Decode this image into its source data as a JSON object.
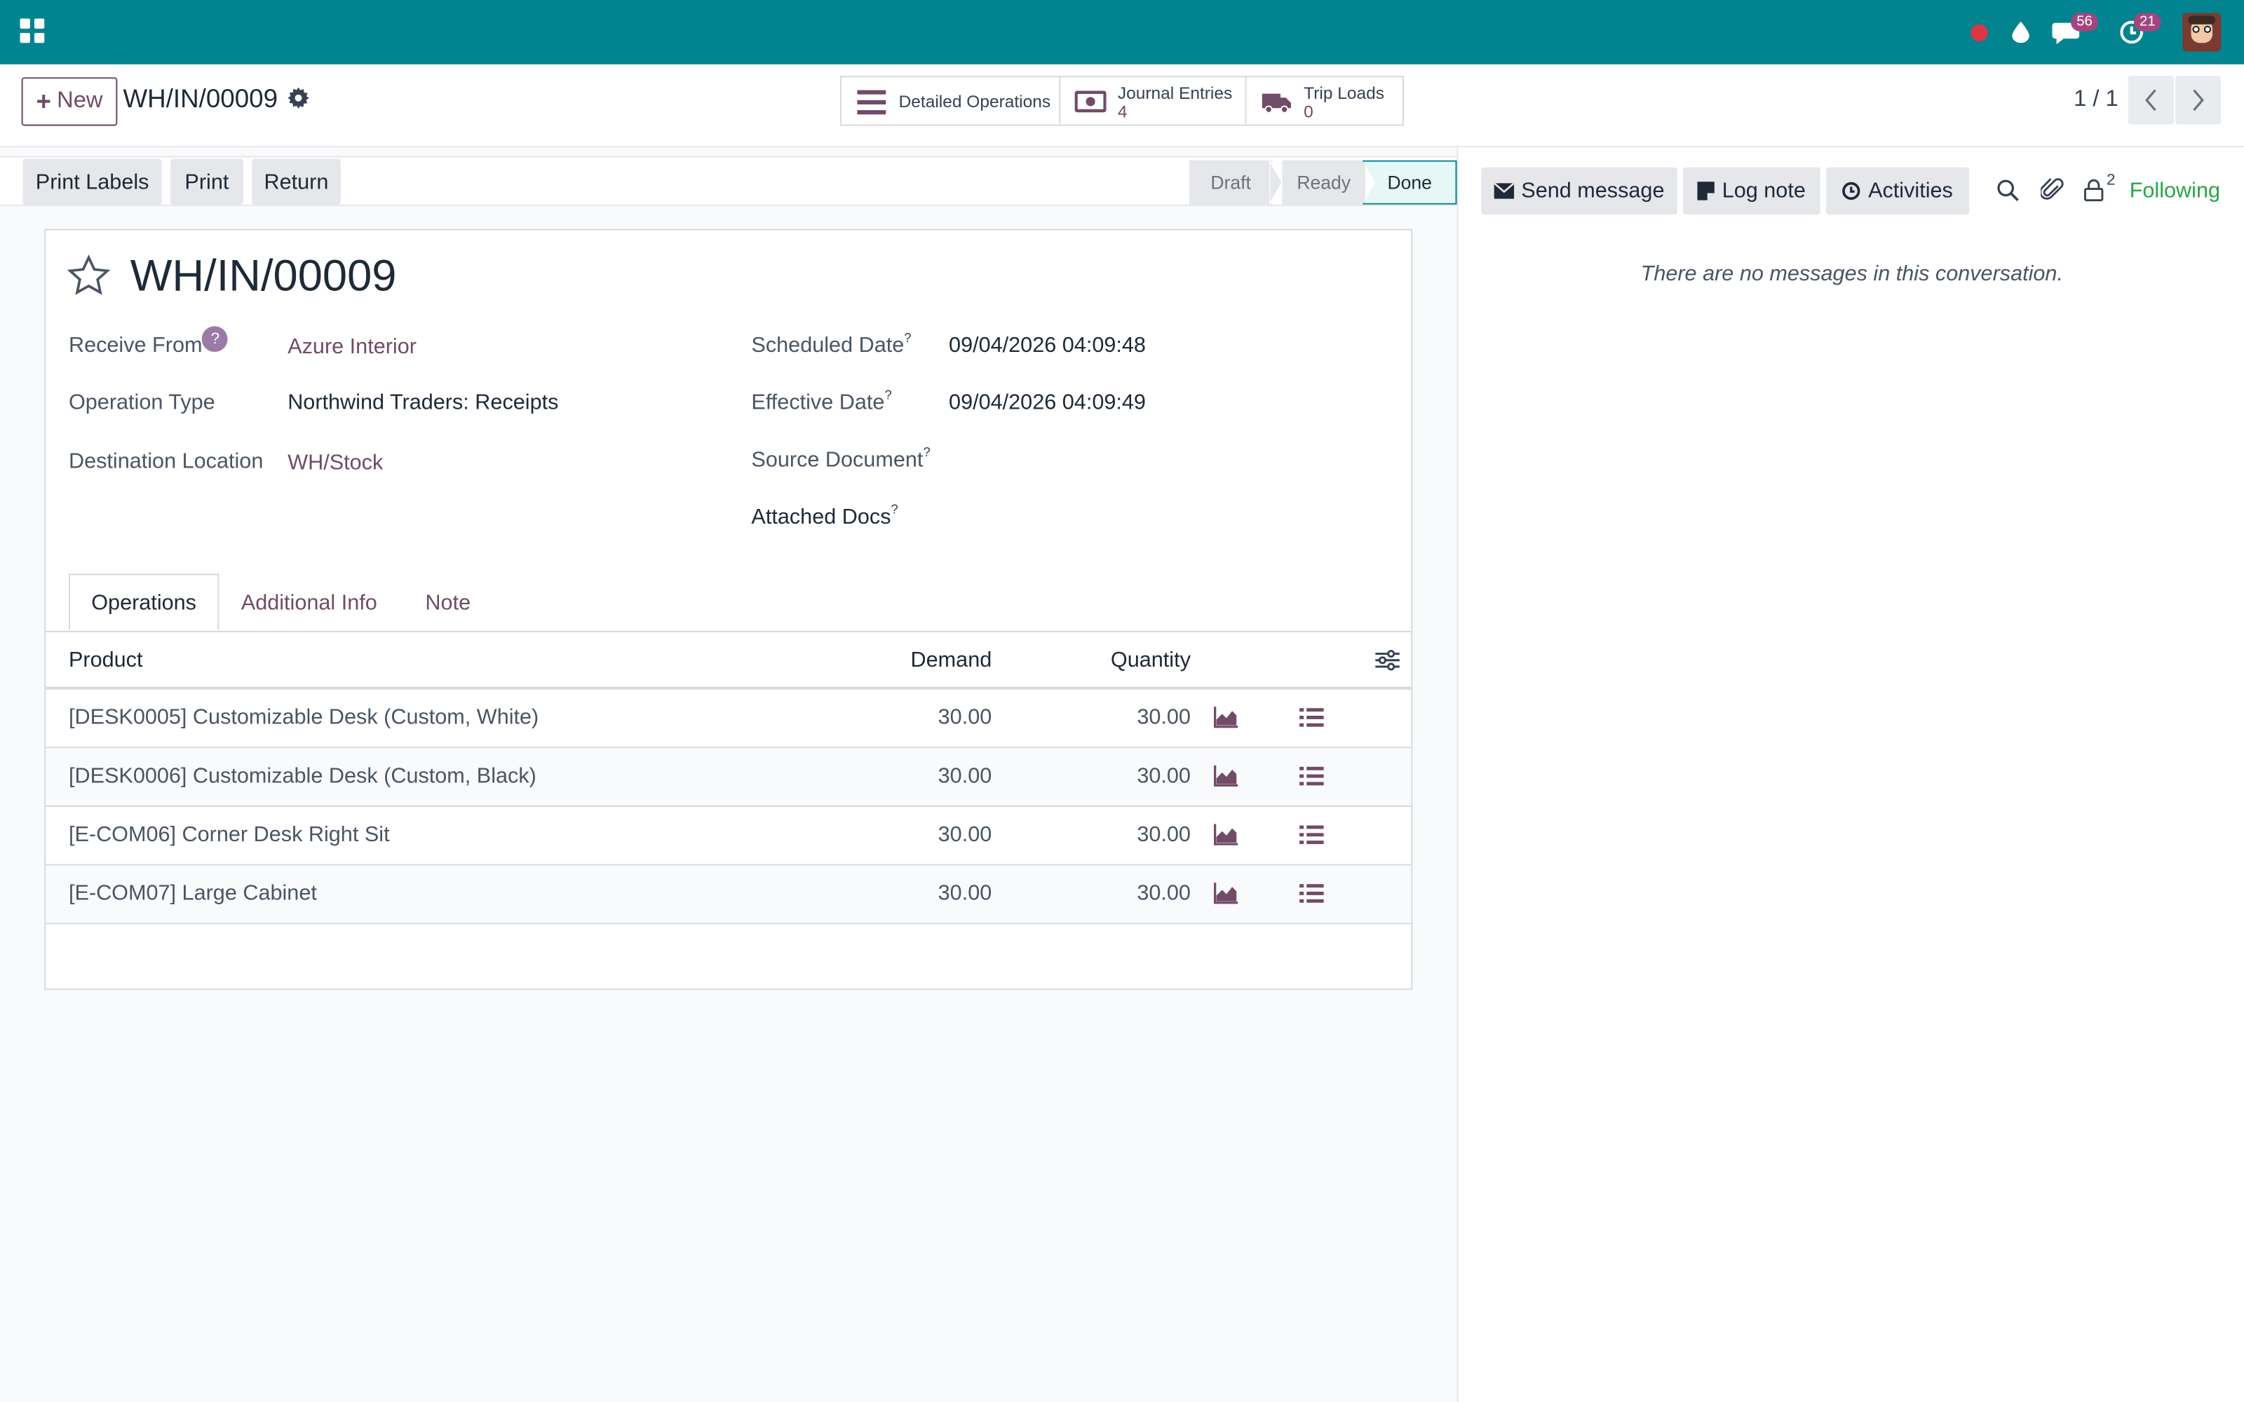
{
  "topbar": {
    "messages_badge": "56",
    "activities_badge": "21"
  },
  "control_panel": {
    "new_label": "New",
    "record_name": "WH/IN/00009",
    "smart_buttons": [
      {
        "label": "Detailed Operations",
        "count": ""
      },
      {
        "label": "Journal Entries",
        "count": "4"
      },
      {
        "label": "Trip Loads",
        "count": "0"
      }
    ],
    "pager": "1 / 1"
  },
  "actions": {
    "print_labels": "Print Labels",
    "print": "Print",
    "return": "Return"
  },
  "stages": {
    "draft": "Draft",
    "ready": "Ready",
    "done": "Done",
    "current": "Done"
  },
  "form": {
    "title": "WH/IN/00009",
    "receive_from_label": "Receive From",
    "receive_from_help": "?",
    "receive_from": "Azure Interior",
    "operation_type_label": "Operation Type",
    "operation_type": "Northwind Traders: Receipts",
    "destination_label": "Destination Location",
    "destination": "WH/Stock",
    "scheduled_date_label": "Scheduled Date",
    "scheduled_date": "09/04/2026 04:09:48",
    "effective_date_label": "Effective Date",
    "effective_date": "09/04/2026 04:09:49",
    "source_document_label": "Source Document",
    "attached_docs_label": "Attached Docs",
    "help_mark": "?"
  },
  "tabs": {
    "operations": "Operations",
    "additional_info": "Additional Info",
    "note": "Note"
  },
  "table": {
    "headers": {
      "product": "Product",
      "demand": "Demand",
      "quantity": "Quantity"
    },
    "rows": [
      {
        "product": "[DESK0005] Customizable Desk (Custom, White)",
        "demand": "30.00",
        "quantity": "30.00"
      },
      {
        "product": "[DESK0006] Customizable Desk (Custom, Black)",
        "demand": "30.00",
        "quantity": "30.00"
      },
      {
        "product": "[E-COM06] Corner Desk Right Sit",
        "demand": "30.00",
        "quantity": "30.00"
      },
      {
        "product": "[E-COM07] Large Cabinet",
        "demand": "30.00",
        "quantity": "30.00"
      }
    ]
  },
  "chatter": {
    "send_message": "Send message",
    "log_note": "Log note",
    "activities": "Activities",
    "followers_count": "2",
    "following": "Following",
    "empty": "There are no messages in this conversation."
  },
  "colors": {
    "topbar": "#01848f",
    "primary": "#714b67",
    "following": "#28a745",
    "done_stage": "#e6f7f8"
  }
}
